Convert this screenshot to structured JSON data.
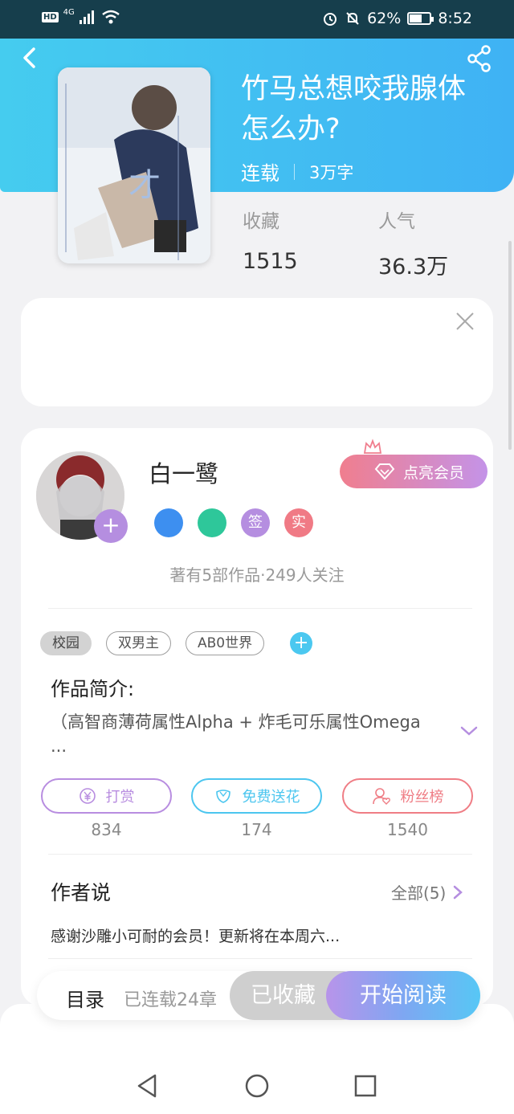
{
  "status_bar": {
    "network": "HD",
    "signal": "4G",
    "battery": "62%",
    "battery_level": 0.62,
    "time": "8:52"
  },
  "book": {
    "title": "竹马总想咬我腺体怎么办?",
    "status": "连载",
    "word_count": "3万字",
    "stats": [
      {
        "label": "收藏",
        "value": "1515"
      },
      {
        "label": "人气",
        "value": "36.3万"
      }
    ]
  },
  "author": {
    "name": "白一鹭",
    "vip_button": "点亮会员",
    "badges": [
      {
        "icon": "phone-badge-icon",
        "label": "",
        "color": "#3d8ff0"
      },
      {
        "icon": "handshake-badge-icon",
        "label": "",
        "color": "#2ec79a"
      },
      {
        "icon": "sign-badge-icon",
        "label": "签",
        "color": "#b58ee0"
      },
      {
        "icon": "real-name-badge-icon",
        "label": "实",
        "color": "#f07a85"
      }
    ],
    "summary": "著有5部作品·249人关注"
  },
  "tags": [
    "校园",
    "双男主",
    "AB0世界"
  ],
  "intro": {
    "heading": "作品简介:",
    "text": "（高智商薄荷属性Alpha + 炸毛可乐属性Omega ..."
  },
  "actions": [
    {
      "label": "打赏",
      "count": "834",
      "icon": "yen-icon",
      "color": "#b88de0"
    },
    {
      "label": "免费送花",
      "count": "174",
      "icon": "flower-icon",
      "color": "#4cc6ef"
    },
    {
      "label": "粉丝榜",
      "count": "1540",
      "icon": "fan-icon",
      "color": "#ef7d85"
    }
  ],
  "author_says": {
    "heading": "作者说",
    "all_label": "全部(5)",
    "text": "感谢沙雕小可耐的会员！更新将在本周六..."
  },
  "bottom_bar": {
    "toc_label": "目录",
    "chapter_count": "已连载24章",
    "collected_label": "已收藏",
    "read_label": "开始阅读"
  },
  "colors": {
    "header_start": "#45ccef",
    "header_end": "#3fb2f4",
    "accent_purple": "#b58ee0"
  }
}
